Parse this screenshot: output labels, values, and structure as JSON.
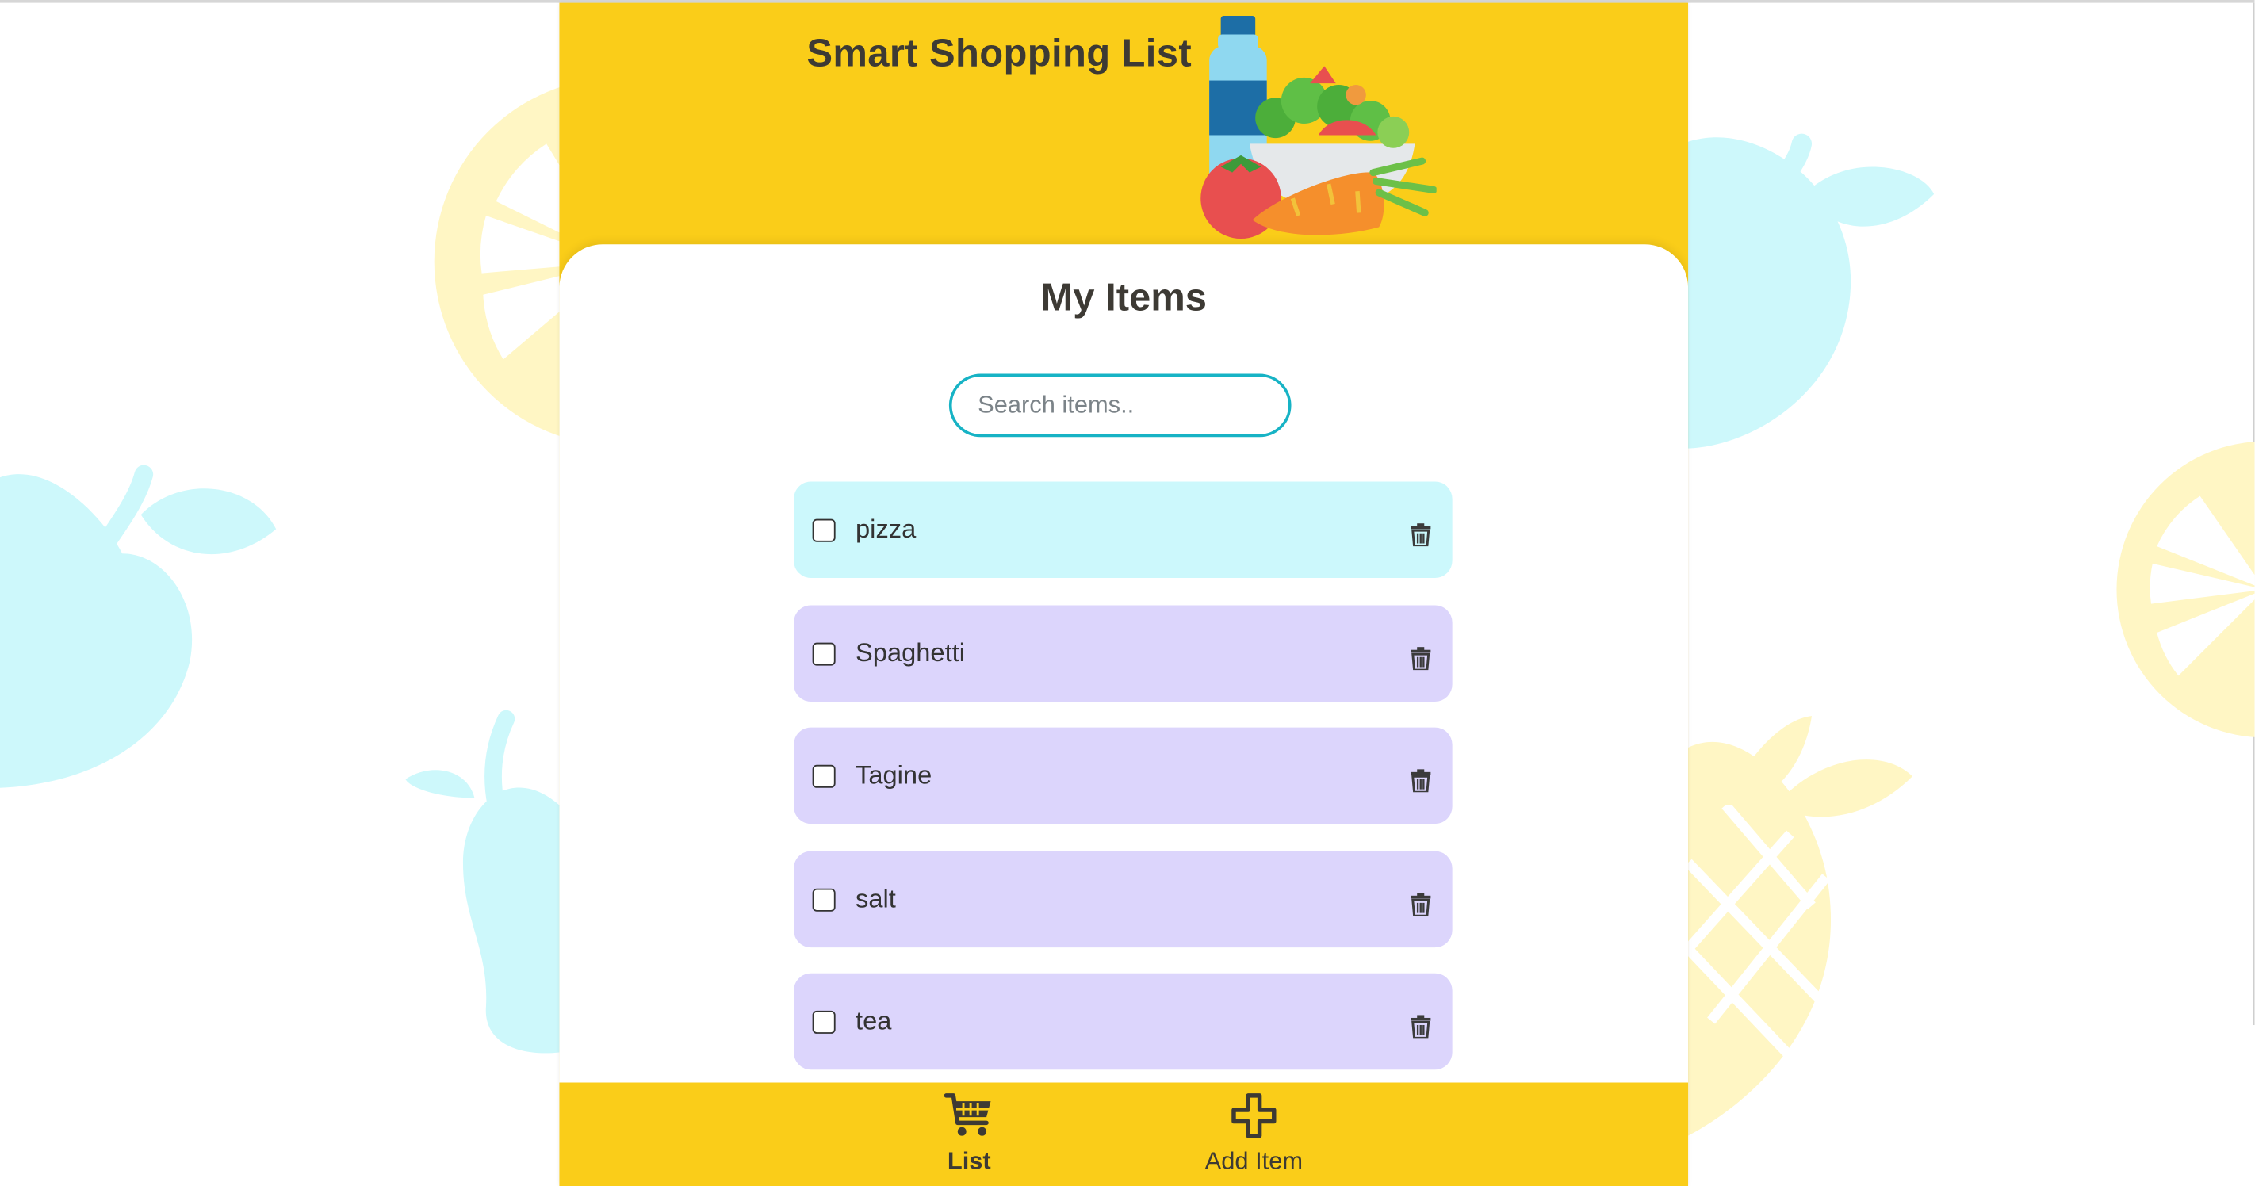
{
  "app": {
    "title": "Smart Shopping List"
  },
  "panel": {
    "title": "My Items"
  },
  "search": {
    "placeholder": "Search items..",
    "value": ""
  },
  "items": [
    {
      "label": "pizza",
      "checked": false,
      "highlighted": true
    },
    {
      "label": "Spaghetti",
      "checked": false,
      "highlighted": false
    },
    {
      "label": "Tagine",
      "checked": false,
      "highlighted": false
    },
    {
      "label": "salt",
      "checked": false,
      "highlighted": false
    },
    {
      "label": "tea",
      "checked": false,
      "highlighted": false
    }
  ],
  "nav": {
    "list_label": "List",
    "add_label": "Add Item"
  },
  "colors": {
    "brand_yellow": "#facd19",
    "item_purple": "#dcd5fc",
    "item_highlight_cyan": "#ccf8fc",
    "search_border": "#17b3c5",
    "text_dark": "#3d3a34",
    "decor_cyan": "#cdf8fb",
    "decor_yellow": "#fff6c4"
  },
  "icons": {
    "list": "cart-icon",
    "add": "plus-icon",
    "delete": "trash-icon",
    "header_art": "groceries-illustration"
  }
}
